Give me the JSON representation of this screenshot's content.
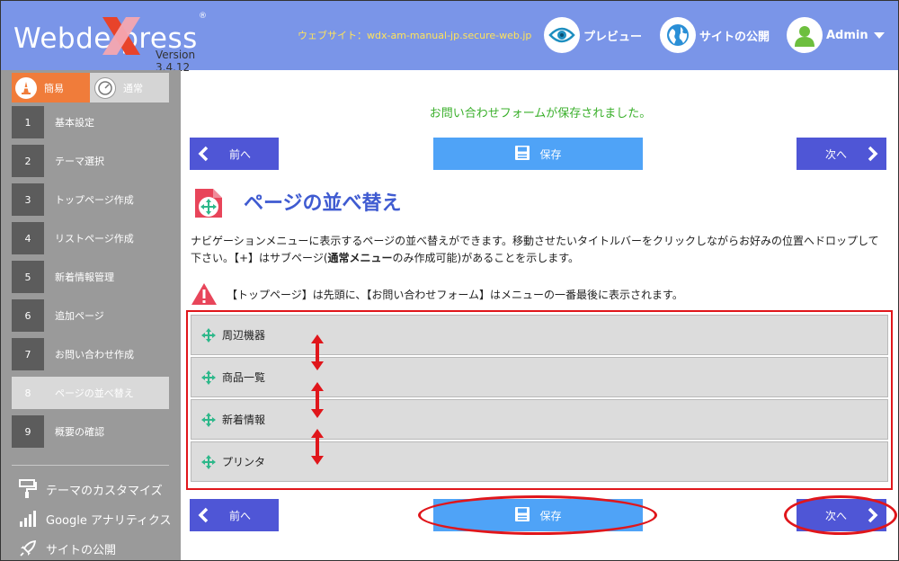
{
  "header": {
    "logo_text": "Webde  press",
    "logo_reg": "®",
    "version": "Version 3.4.12",
    "website": "ウェブサイト：wdx-am-manual-jp.secure-web.jp",
    "preview_label": "プレビュー",
    "publish_label": "サイトの公開",
    "user_label": "Admin"
  },
  "sidebar": {
    "mode_easy": "簡易",
    "mode_normal": "通常",
    "steps": [
      {
        "num": "1",
        "label": "基本設定"
      },
      {
        "num": "2",
        "label": "テーマ選択"
      },
      {
        "num": "3",
        "label": "トップページ作成"
      },
      {
        "num": "4",
        "label": "リストページ作成"
      },
      {
        "num": "5",
        "label": "新着情報管理"
      },
      {
        "num": "6",
        "label": "追加ページ"
      },
      {
        "num": "7",
        "label": "お問い合わせ作成"
      },
      {
        "num": "8",
        "label": "ページの並べ替え"
      },
      {
        "num": "9",
        "label": "概要の確認"
      }
    ],
    "tools": [
      {
        "label": "テーマのカスタマイズ"
      },
      {
        "label": "Google アナリティクス"
      },
      {
        "label": "サイトの公開"
      }
    ]
  },
  "main": {
    "saved_message": "お問い合わせフォームが保存されました。",
    "prev_label": "前へ",
    "save_label": "保存",
    "next_label": "次へ",
    "title": "ページの並べ替え",
    "desc_1": "ナビゲーションメニューに表示するページの並べ替えができます。移動させたいタイトルバーをクリックしながらお好みの位置へドロップして下さい。【+】はサブページ(",
    "desc_bold": "通常メニュー",
    "desc_2": "のみ作成可能)があることを示します。",
    "warning": "【トップページ】は先頭に、【お問い合わせフォーム】はメニューの一番最後に表示されます。",
    "pages": [
      {
        "label": "周辺機器"
      },
      {
        "label": "商品一覧"
      },
      {
        "label": "新着情報"
      },
      {
        "label": "プリンタ"
      }
    ]
  },
  "colors": {
    "header_bg": "#7a95e8",
    "sidebar_bg": "#9a9a9a",
    "nav_button": "#4f56d6",
    "save_button": "#4fa3f7",
    "accent_orange": "#f07c3a",
    "success_green": "#3bb02c",
    "highlight_red": "#e0161b"
  }
}
